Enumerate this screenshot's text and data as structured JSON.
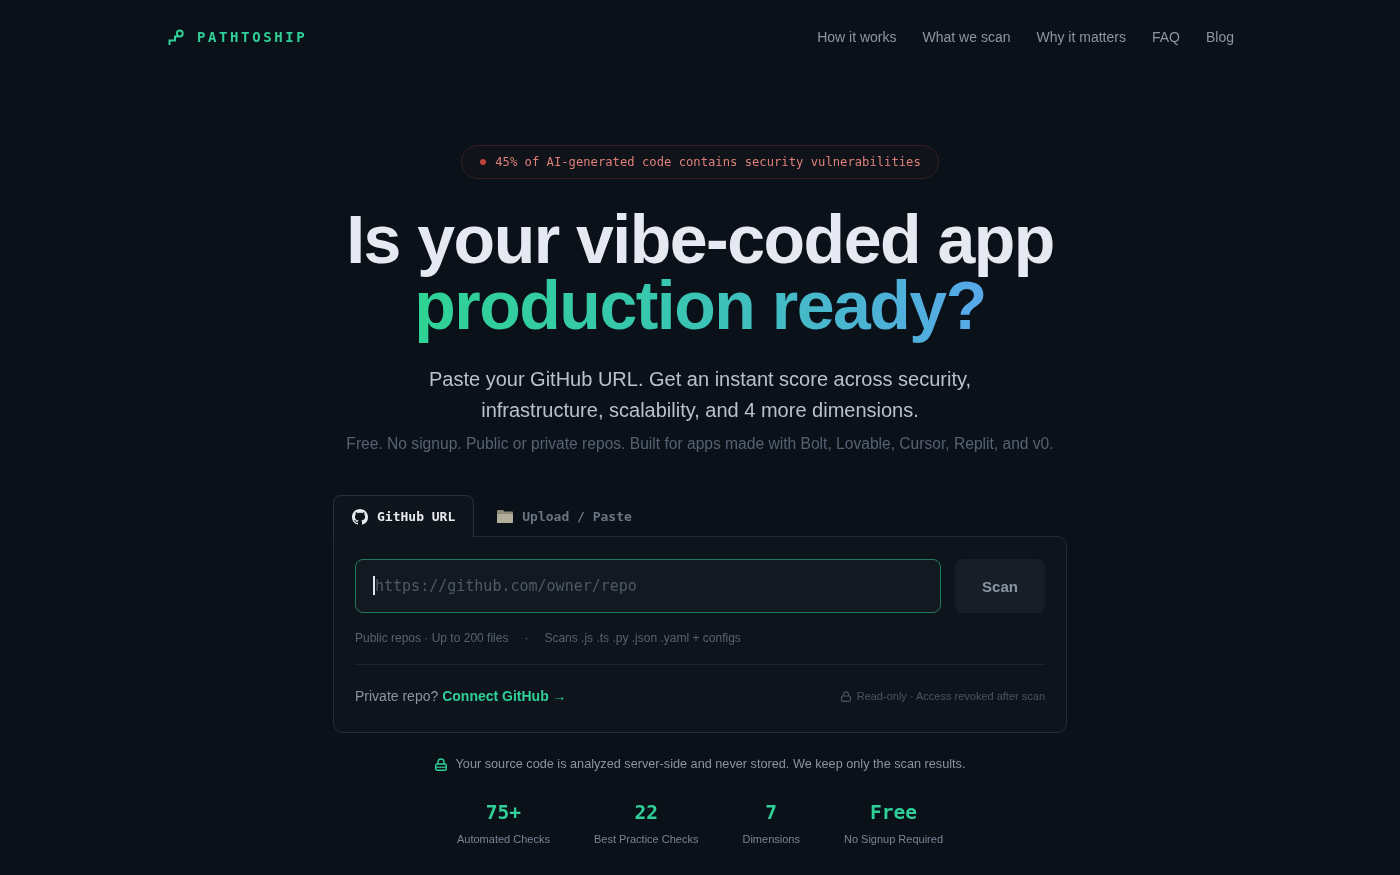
{
  "nav": {
    "logo": "PATHTOSHIP",
    "links": [
      "How it works",
      "What we scan",
      "Why it matters",
      "FAQ",
      "Blog"
    ]
  },
  "badge": {
    "text": "45% of AI-generated code contains security vulnerabilities"
  },
  "hero": {
    "headline": "Is your vibe-coded app",
    "highlight": "production ready?",
    "subtitle": "Paste your GitHub URL. Get an instant score across security, infrastructure, scalability, and 4 more dimensions.",
    "note": "Free. No signup. Public or private repos. Built for apps made with Bolt, Lovable, Cursor, Replit, and v0."
  },
  "scanner": {
    "tabs": [
      {
        "label": "GitHub URL",
        "kind": "github",
        "selected": true
      },
      {
        "label": "Upload / Paste",
        "kind": "folder",
        "selected": false
      }
    ],
    "url_field": {
      "placeholder": "https://github.com/owner/repo",
      "focused": true
    },
    "scan_button": {
      "label": "Scan",
      "disabled": true
    },
    "hints": [
      "Public repos · Up to 200 files",
      "Scans .js .ts .py .json .yaml + configs"
    ],
    "hint_separator": "·",
    "private_prompt": "Private repo?",
    "connect_link": "Connect GitHub →",
    "access_note": "Read-only · Access revoked after scan"
  },
  "privacy_note": "Your source code is analyzed server-side and never stored. We keep only the scan results.",
  "stats": [
    {
      "value": "75+",
      "label": "Automated Checks"
    },
    {
      "value": "22",
      "label": "Best Practice Checks"
    },
    {
      "value": "7",
      "label": "Dimensions"
    },
    {
      "value": "Free",
      "label": "No Signup Required"
    }
  ]
}
